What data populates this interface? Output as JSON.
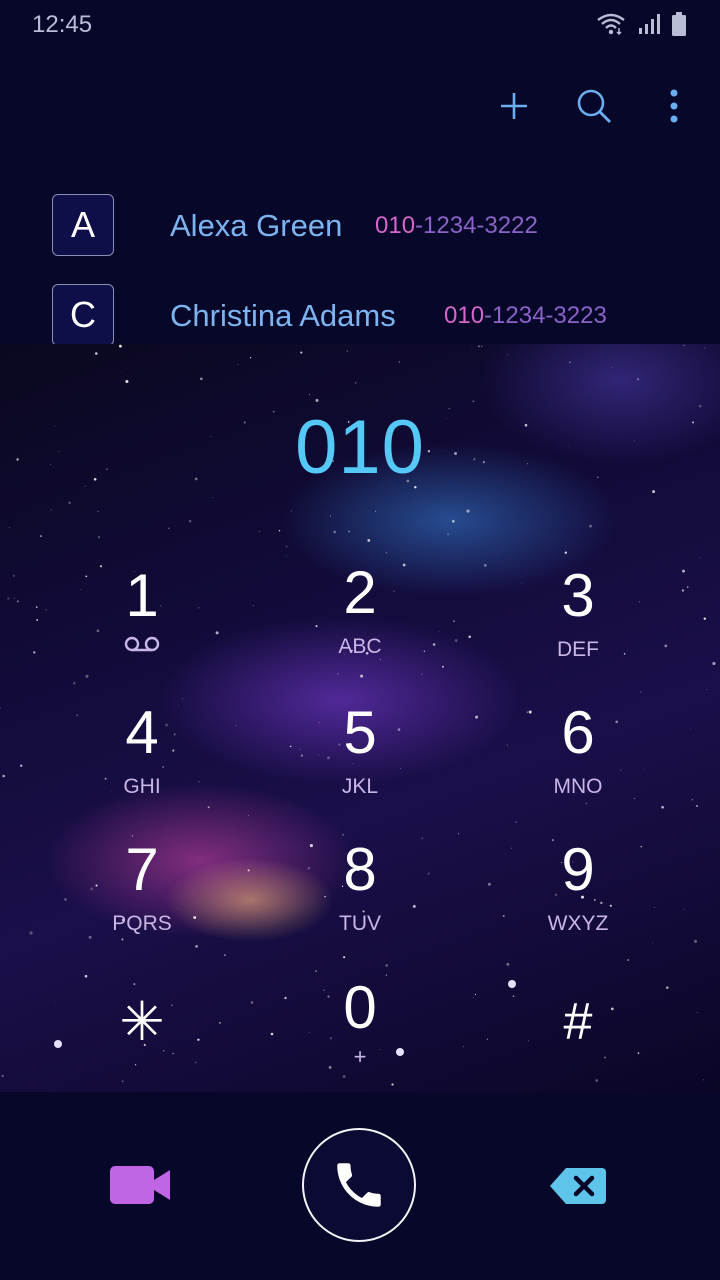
{
  "status_bar": {
    "time": "12:45",
    "icons": [
      "wifi-icon",
      "signal-icon",
      "battery-icon"
    ]
  },
  "toolbar": {
    "icons": [
      "add-icon",
      "search-icon",
      "more-vert-icon"
    ]
  },
  "contacts": [
    {
      "initial": "A",
      "name": "Alexa Green",
      "number_match": "010",
      "number_rest": "-1234-3222"
    },
    {
      "initial": "C",
      "name": "Christina Adams",
      "number_match": "010",
      "number_rest": "-1234-3223"
    }
  ],
  "dialed_number": "010",
  "keypad": [
    {
      "digit": "1",
      "letters": "",
      "extra_icon": "voicemail-icon"
    },
    {
      "digit": "2",
      "letters": "ABC"
    },
    {
      "digit": "3",
      "letters": "DEF"
    },
    {
      "digit": "4",
      "letters": "GHI"
    },
    {
      "digit": "5",
      "letters": "JKL"
    },
    {
      "digit": "6",
      "letters": "MNO"
    },
    {
      "digit": "7",
      "letters": "PQRS"
    },
    {
      "digit": "8",
      "letters": "TUV"
    },
    {
      "digit": "9",
      "letters": "WXYZ"
    },
    {
      "digit": "✳",
      "letters": ""
    },
    {
      "digit": "0",
      "letters": "+"
    },
    {
      "digit": "#",
      "letters": ""
    }
  ],
  "bottom_bar": {
    "icons": [
      "video-call-icon",
      "phone-call-icon",
      "backspace-icon"
    ]
  },
  "colors": {
    "background": "#07072a",
    "name": "#7db4f0",
    "number_match": "#d666c9",
    "number_rest": "#8b62c6",
    "dialed": "#55c8f5",
    "video": "#c065e3",
    "backspace": "#5fc4ea"
  }
}
